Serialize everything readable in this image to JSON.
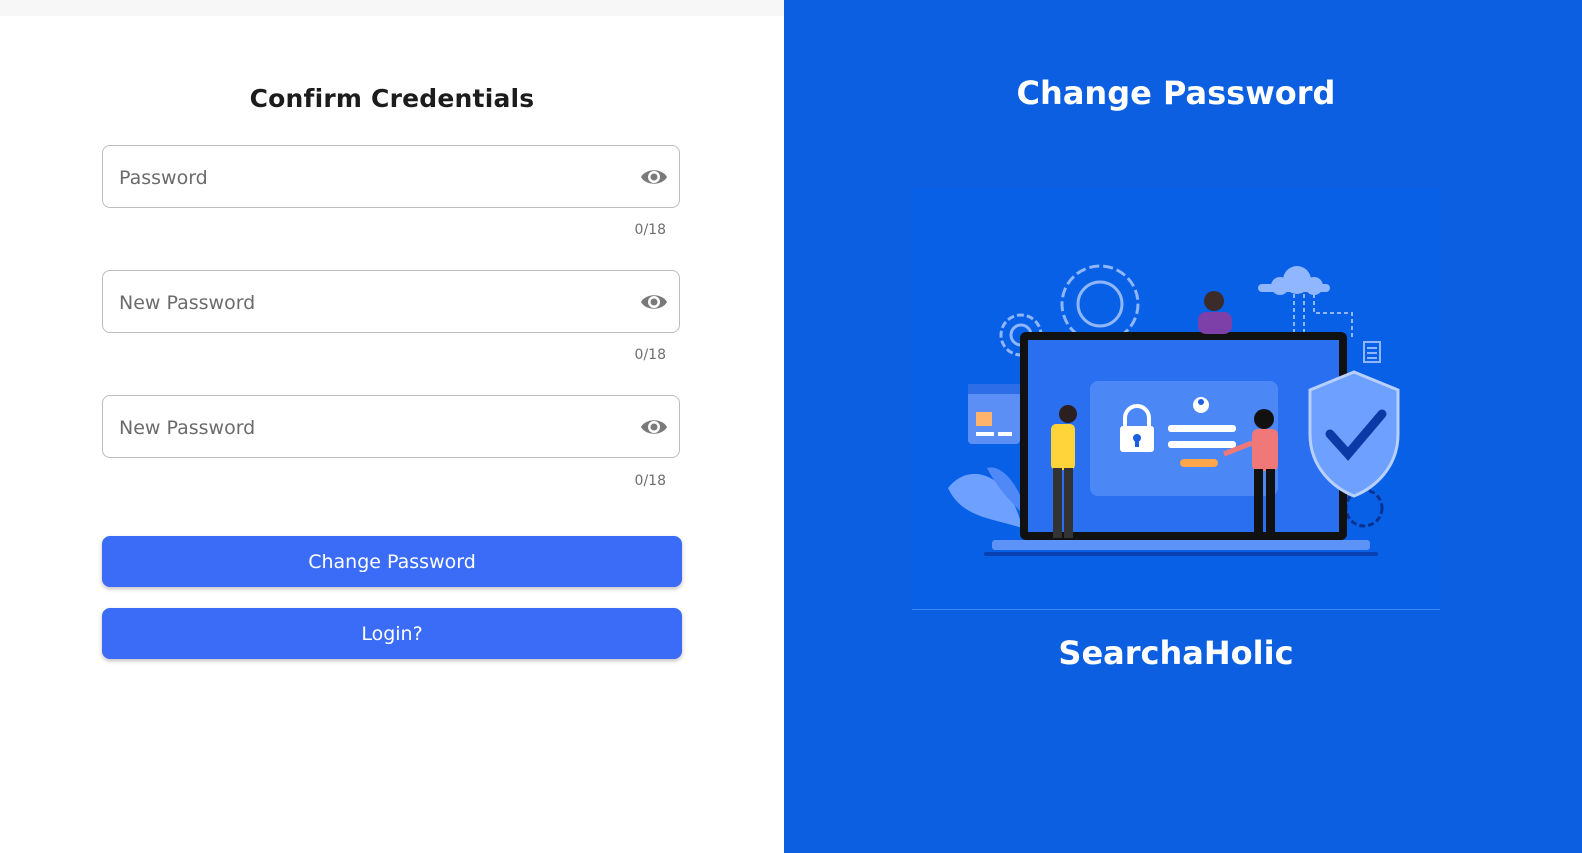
{
  "form": {
    "title": "Confirm Credentials",
    "fields": [
      {
        "placeholder": "Password",
        "value": "",
        "counter": "0/18",
        "icon": "eye-icon"
      },
      {
        "placeholder": "New Password",
        "value": "",
        "counter": "0/18",
        "icon": "eye-icon"
      },
      {
        "placeholder": "New Password",
        "value": "",
        "counter": "0/18",
        "icon": "eye-icon"
      }
    ],
    "change_button_label": "Change Password",
    "login_button_label": "Login?"
  },
  "side": {
    "title": "Change Password",
    "brand": "SearchaHolic"
  },
  "colors": {
    "accent": "#3a6cf7",
    "panel": "#0b5fe0"
  }
}
